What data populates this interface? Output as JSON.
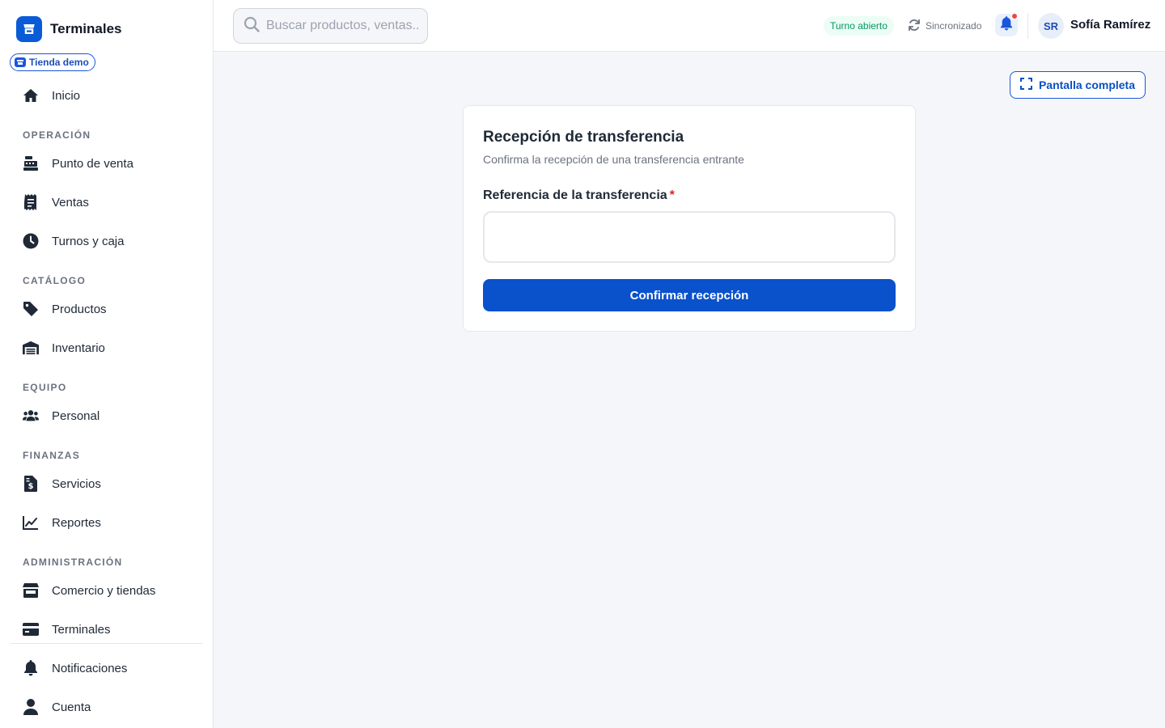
{
  "brand": {
    "name": "Terminales",
    "store_badge": "Tienda demo"
  },
  "sidebar": {
    "top_items": [
      {
        "label": "Inicio",
        "icon": "home-icon"
      }
    ],
    "sections": [
      {
        "title": "OPERACIÓN",
        "items": [
          {
            "label": "Punto de venta",
            "icon": "cash-register-icon"
          },
          {
            "label": "Ventas",
            "icon": "receipt-icon"
          },
          {
            "label": "Turnos y caja",
            "icon": "clock-icon"
          }
        ]
      },
      {
        "title": "CATÁLOGO",
        "items": [
          {
            "label": "Productos",
            "icon": "tag-icon"
          },
          {
            "label": "Inventario",
            "icon": "warehouse-icon"
          }
        ]
      },
      {
        "title": "EQUIPO",
        "items": [
          {
            "label": "Personal",
            "icon": "users-icon"
          }
        ]
      },
      {
        "title": "FINANZAS",
        "items": [
          {
            "label": "Servicios",
            "icon": "invoice-dollar-icon"
          },
          {
            "label": "Reportes",
            "icon": "chart-line-icon"
          }
        ]
      },
      {
        "title": "ADMINISTRACIÓN",
        "items": [
          {
            "label": "Comercio y tiendas",
            "icon": "store-icon"
          },
          {
            "label": "Terminales",
            "icon": "credit-card-icon"
          }
        ]
      }
    ],
    "bottom_items": [
      {
        "label": "Notificaciones",
        "icon": "bell-icon"
      },
      {
        "label": "Cuenta",
        "icon": "user-icon"
      }
    ]
  },
  "header": {
    "search_placeholder": "Buscar productos, ventas...",
    "shift_status": "Turno abierto",
    "sync_status": "Sincronizado",
    "user": {
      "initials": "SR",
      "name": "Sofía Ramírez"
    }
  },
  "main": {
    "fullscreen_label": "Pantalla completa",
    "card": {
      "title": "Recepción de transferencia",
      "subtitle": "Confirma la recepción de una transferencia entrante",
      "field_label": "Referencia de la transferencia",
      "required_mark": "*",
      "field_value": "",
      "submit_label": "Confirmar recepción"
    }
  },
  "colors": {
    "primary": "#0a51cc",
    "success": "#059669",
    "danger": "#dc2626"
  }
}
